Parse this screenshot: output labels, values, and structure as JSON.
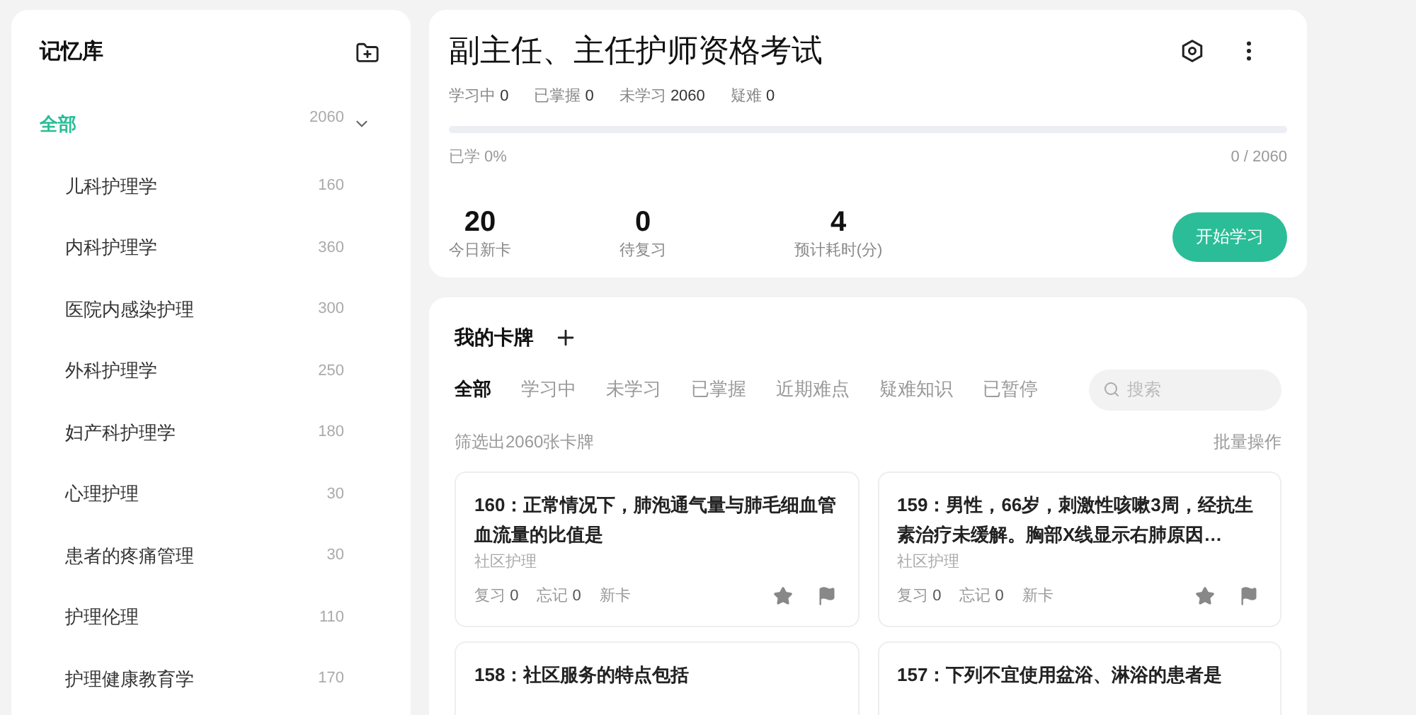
{
  "sidebar": {
    "title": "记忆库",
    "items": [
      {
        "label": "全部",
        "count": "2060",
        "selected": true,
        "expanded": true,
        "children": [
          {
            "label": "儿科护理学",
            "count": "160",
            "selected": false
          },
          {
            "label": "内科护理学",
            "count": "360",
            "selected": false
          },
          {
            "label": "医院内感染护理",
            "count": "300",
            "selected": false
          },
          {
            "label": "外科护理学",
            "count": "250",
            "selected": false
          },
          {
            "label": "妇产科护理学",
            "count": "180",
            "selected": false
          },
          {
            "label": "心理护理",
            "count": "30",
            "selected": false
          },
          {
            "label": "患者的疼痛管理",
            "count": "30",
            "selected": false
          },
          {
            "label": "护理伦理",
            "count": "110",
            "selected": false
          },
          {
            "label": "护理健康教育学",
            "count": "170",
            "selected": false
          }
        ]
      }
    ]
  },
  "deck": {
    "title": "副主任、主任护师资格考试",
    "stats": [
      {
        "label": "学习中",
        "value": "0"
      },
      {
        "label": "已掌握",
        "value": "0"
      },
      {
        "label": "未学习",
        "value": "2060"
      },
      {
        "label": "疑难",
        "value": "0"
      }
    ],
    "progress": {
      "level": 0,
      "label": "已学 0%",
      "reading": "0 / 2060"
    },
    "summary": [
      {
        "value": "20",
        "label": "今日新卡"
      },
      {
        "value": "0",
        "label": "待复习"
      },
      {
        "value": "4",
        "label": "预计耗时(分)"
      }
    ],
    "start_button": "开始学习"
  },
  "cards_panel": {
    "title": "我的卡牌",
    "tabs": [
      {
        "label": "全部",
        "selected": true
      },
      {
        "label": "学习中",
        "selected": false
      },
      {
        "label": "未学习",
        "selected": false
      },
      {
        "label": "已掌握",
        "selected": false
      },
      {
        "label": "近期难点",
        "selected": false
      },
      {
        "label": "疑难知识",
        "selected": false
      },
      {
        "label": "已暂停",
        "selected": false
      }
    ],
    "search": {
      "placeholder": "搜索"
    },
    "filter_text": "筛选出2060张卡牌",
    "batch_action": "批量操作",
    "cards": [
      {
        "question": "160：正常情况下，肺泡通气量与肺毛细血管血流量的比值是",
        "category": "社区护理",
        "review": "复习",
        "review_count": "0",
        "forget": "忘记",
        "forget_count": "0",
        "status": "新卡"
      },
      {
        "question": "159：男性，66岁，刺激性咳嗽3周，经抗生素治疗未缓解。胸部X线显示右肺原因…",
        "category": "社区护理",
        "review": "复习",
        "review_count": "0",
        "forget": "忘记",
        "forget_count": "0",
        "status": "新卡"
      },
      {
        "question": "158：社区服务的特点包括"
      },
      {
        "question": "157：下列不宜使用盆浴、淋浴的患者是"
      }
    ]
  }
}
